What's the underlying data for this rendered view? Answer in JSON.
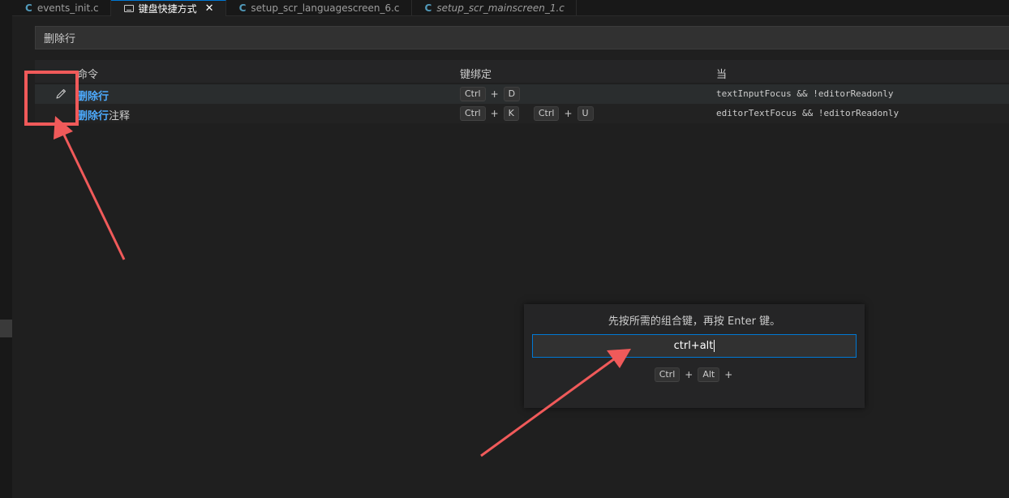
{
  "tabs": [
    {
      "label": "events_init.c",
      "type": "c",
      "active": false,
      "italic": false
    },
    {
      "label": "键盘快捷方式",
      "type": "keyboard",
      "active": true,
      "italic": false
    },
    {
      "label": "setup_scr_languagescreen_6.c",
      "type": "c",
      "active": false,
      "italic": false
    },
    {
      "label": "setup_scr_mainscreen_1.c",
      "type": "c",
      "active": false,
      "italic": true
    }
  ],
  "tab_icon_letter": "C",
  "tab_close_glyph": "✕",
  "search": {
    "value": "删除行"
  },
  "table": {
    "headers": {
      "command": "命令",
      "keybinding": "键绑定",
      "when": "当"
    },
    "rows": [
      {
        "command_highlight": "删除行",
        "command_rest": "",
        "keys": [
          [
            "Ctrl",
            "D"
          ]
        ],
        "when": "textInputFocus && !editorReadonly"
      },
      {
        "command_highlight": "删除行",
        "command_rest": "注释",
        "keys": [
          [
            "Ctrl",
            "K"
          ],
          [
            "Ctrl",
            "U"
          ]
        ],
        "when": "editorTextFocus && !editorReadonly"
      }
    ]
  },
  "dialog": {
    "message": "先按所需的组合键，再按 Enter 键。",
    "input_value": "ctrl+alt",
    "preview_keys": [
      "Ctrl",
      "Alt"
    ],
    "preview_trailing": "+"
  },
  "plus_sign": "+",
  "colors": {
    "accent": "#0078d4",
    "highlight": "#4daafc",
    "annotation": "#f05a5a",
    "c_icon": "#519aba"
  },
  "icons": {
    "edit": "pencil-icon",
    "tab_keyboard": "keyboard-icon",
    "tab_c": "c-file-icon",
    "close": "close-icon"
  }
}
